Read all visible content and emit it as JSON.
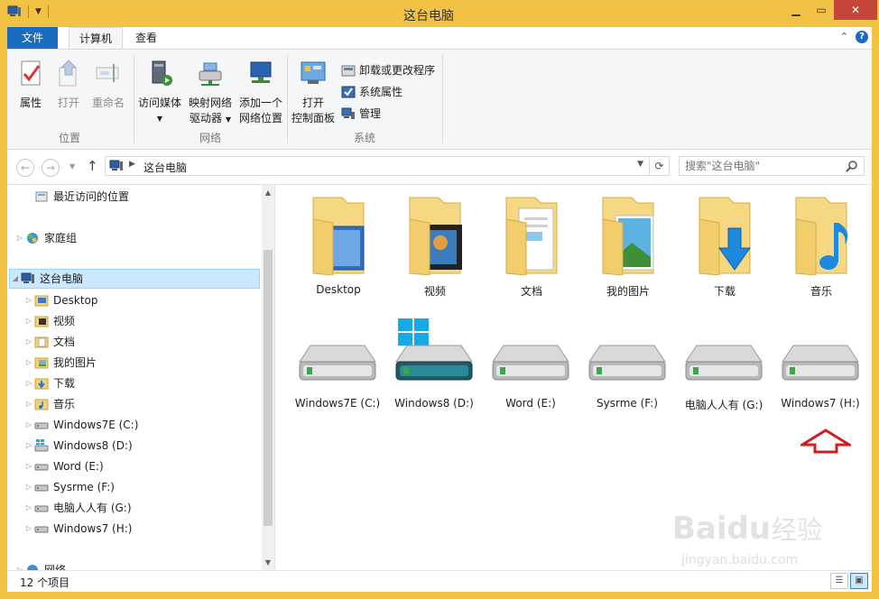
{
  "window": {
    "title": "这台电脑",
    "controls": {
      "minimize": "▁",
      "maximize": "▭",
      "close": "✕"
    }
  },
  "ribbon_tabs": [
    {
      "label": "文件",
      "active": false
    },
    {
      "label": "计算机",
      "active": true
    },
    {
      "label": "查看",
      "active": false
    }
  ],
  "ribbon": {
    "groups": [
      {
        "label": "位置",
        "buttons": [
          "属性",
          "打开",
          "重命名"
        ]
      },
      {
        "label": "网络",
        "buttons": [
          "访问媒体",
          "映射网络",
          "驱动器",
          "添加一个",
          "网络位置"
        ]
      },
      {
        "label": "系统",
        "buttons": [
          "打开",
          "控制面板"
        ],
        "small_buttons": [
          "卸载或更改程序",
          "系统属性",
          "管理"
        ]
      }
    ]
  },
  "address": {
    "crumb": "这台电脑"
  },
  "search": {
    "placeholder": "搜索\"这台电脑\""
  },
  "nav_tree": [
    {
      "label": "最近访问的位置",
      "icon": "recent-places-icon",
      "level": 1
    },
    {
      "label": "家庭组",
      "icon": "homegroup-icon",
      "level": 0
    },
    {
      "label": "这台电脑",
      "icon": "computer-icon",
      "level": 0,
      "selected": true
    },
    {
      "label": "Desktop",
      "icon": "desktop-folder-icon",
      "level": 1
    },
    {
      "label": "视频",
      "icon": "videos-folder-icon",
      "level": 1
    },
    {
      "label": "文档",
      "icon": "documents-folder-icon",
      "level": 1
    },
    {
      "label": "我的图片",
      "icon": "pictures-folder-icon",
      "level": 1
    },
    {
      "label": "下载",
      "icon": "downloads-folder-icon",
      "level": 1
    },
    {
      "label": "音乐",
      "icon": "music-folder-icon",
      "level": 1
    },
    {
      "label": "Windows7E (C:)",
      "icon": "drive-icon",
      "level": 1
    },
    {
      "label": "Windows8 (D:)",
      "icon": "windows-drive-icon",
      "level": 1
    },
    {
      "label": "Word (E:)",
      "icon": "drive-icon",
      "level": 1
    },
    {
      "label": "Sysrme (F:)",
      "icon": "drive-icon",
      "level": 1
    },
    {
      "label": "电脑人人有 (G:)",
      "icon": "drive-icon",
      "level": 1
    },
    {
      "label": "Windows7 (H:)",
      "icon": "drive-icon",
      "level": 1
    },
    {
      "label": "网络",
      "icon": "network-icon",
      "level": 0
    }
  ],
  "folders": [
    {
      "label": "Desktop",
      "icon": "desktop-folder-icon"
    },
    {
      "label": "视频",
      "icon": "videos-folder-icon"
    },
    {
      "label": "文档",
      "icon": "documents-folder-icon"
    },
    {
      "label": "我的图片",
      "icon": "pictures-folder-icon"
    },
    {
      "label": "下载",
      "icon": "downloads-folder-icon"
    },
    {
      "label": "音乐",
      "icon": "music-folder-icon"
    }
  ],
  "drives": [
    {
      "label": "Windows7E (C:)",
      "windows_logo": false
    },
    {
      "label": "Windows8 (D:)",
      "windows_logo": true
    },
    {
      "label": "Word (E:)",
      "windows_logo": false
    },
    {
      "label": "Sysrme (F:)",
      "windows_logo": false
    },
    {
      "label": "电脑人人有 (G:)",
      "windows_logo": false
    },
    {
      "label": "Windows7 (H:)",
      "windows_logo": false
    }
  ],
  "status": {
    "count": "12 个项目"
  },
  "watermark": {
    "brand": "Baidu",
    "cn": "经验",
    "url": "jingyan.baidu.com"
  },
  "colors": {
    "titlebar": "#f2c244",
    "file_tab": "#1b6bc0",
    "close": "#c7463c",
    "selection": "#cce8ff",
    "annotation_arrow": "#cc1f1f"
  }
}
